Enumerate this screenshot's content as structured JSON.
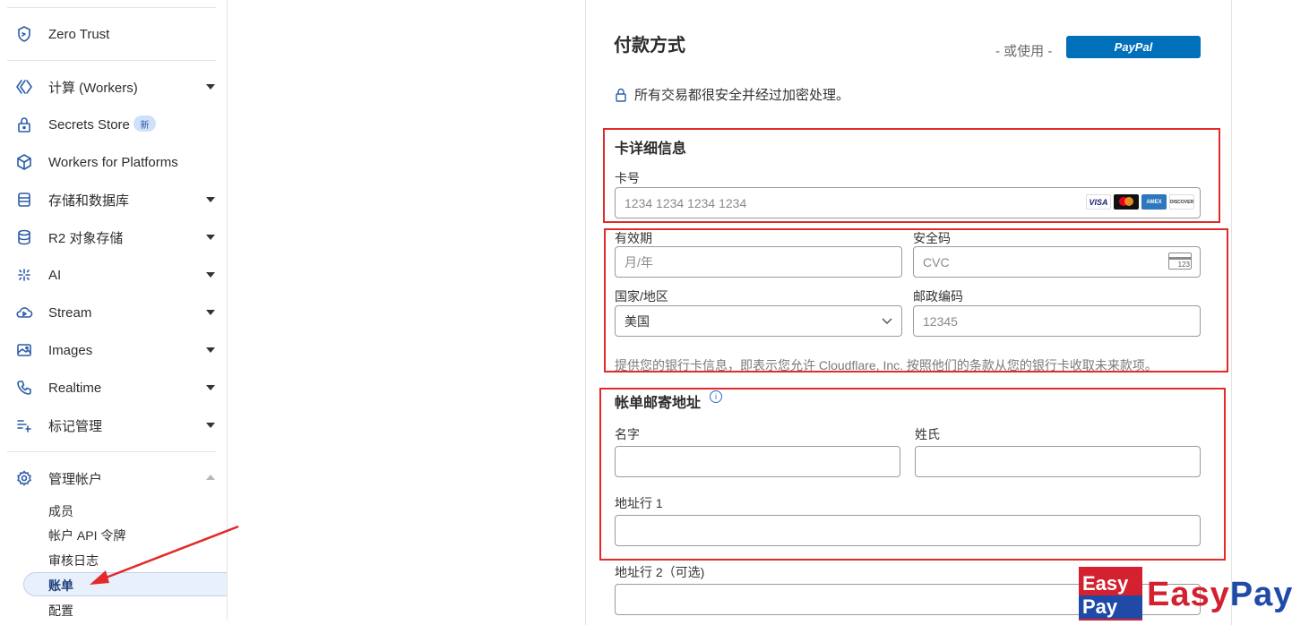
{
  "sidebar": {
    "items": [
      {
        "label": "Zero Trust",
        "icon": "zero-trust-icon"
      },
      {
        "label": "计算 (Workers)",
        "icon": "workers-icon"
      },
      {
        "label": "Secrets Store",
        "icon": "lock-icon",
        "badge": "新"
      },
      {
        "label": "Workers for Platforms",
        "icon": "cube-icon"
      },
      {
        "label": "存储和数据库",
        "icon": "storage-icon"
      },
      {
        "label": "R2 对象存储",
        "icon": "database-icon"
      },
      {
        "label": "AI",
        "icon": "sparkle-icon"
      },
      {
        "label": "Stream",
        "icon": "stream-icon"
      },
      {
        "label": "Images",
        "icon": "image-icon"
      },
      {
        "label": "Realtime",
        "icon": "phone-icon"
      },
      {
        "label": "标记管理",
        "icon": "tag-manager-icon"
      },
      {
        "label": "管理帐户",
        "icon": "gear-icon"
      }
    ],
    "subitems": [
      "成员",
      "帐户 API 令牌",
      "审核日志",
      "账单",
      "配置"
    ],
    "active_subitem": "账单"
  },
  "payment": {
    "title": "付款方式",
    "or_use": "- 或使用 -",
    "paypal_label": "PayPal",
    "secure_note": "所有交易都很安全并经过加密处理。",
    "card_details": {
      "title": "卡详细信息",
      "card_number_label": "卡号",
      "card_number_placeholder": "1234 1234 1234 1234",
      "card_brands": [
        "VISA",
        "MasterCard",
        "AMEX",
        "DISCOVER"
      ],
      "expiry_label": "有效期",
      "expiry_placeholder": "月/年",
      "cvc_label": "安全码",
      "cvc_placeholder": "CVC",
      "cvc_icon_text": "123",
      "country_label": "国家/地区",
      "country_value": "美国",
      "postal_label": "邮政编码",
      "postal_placeholder": "12345",
      "consent_note": "提供您的银行卡信息，即表示您允许 Cloudflare, Inc. 按照他们的条款从您的银行卡收取未来款项。"
    },
    "billing_address": {
      "title": "帐单邮寄地址",
      "info_icon": "ⓘ",
      "first_name_label": "名字",
      "last_name_label": "姓氏",
      "address1_label": "地址行 1",
      "address2_label": "地址行 2（可选)"
    }
  },
  "watermark": {
    "line1": "Easy",
    "line2": "Pay",
    "text_a": "Easy",
    "text_b": "Pay"
  },
  "colors": {
    "annotation_red": "#e32a2a",
    "paypal_blue": "#0070ba",
    "accent": "#2c5da8"
  }
}
